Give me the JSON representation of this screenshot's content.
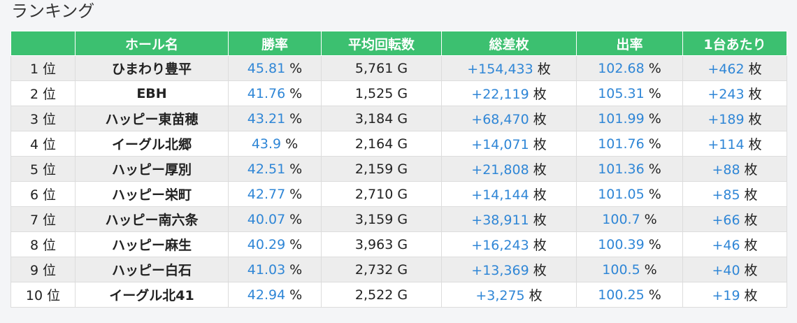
{
  "page": {
    "title": "ランキング"
  },
  "table": {
    "headers": [
      "",
      "ホール名",
      "勝率",
      "平均回転数",
      "総差枚",
      "出率",
      "1台あたり"
    ],
    "units": {
      "rank": "位",
      "percent": "%",
      "spins": "G",
      "coins": "枚"
    },
    "rows": [
      {
        "rank": "1",
        "hall": "ひまわり豊平",
        "win_rate": "45.81",
        "avg_spins": "5,761",
        "total_diff": "+154,433",
        "payout": "102.68",
        "per_machine": "+462"
      },
      {
        "rank": "2",
        "hall": "EBH",
        "win_rate": "41.76",
        "avg_spins": "1,525",
        "total_diff": "+22,119",
        "payout": "105.31",
        "per_machine": "+243"
      },
      {
        "rank": "3",
        "hall": "ハッピー東苗穂",
        "win_rate": "43.21",
        "avg_spins": "3,184",
        "total_diff": "+68,470",
        "payout": "101.99",
        "per_machine": "+189"
      },
      {
        "rank": "4",
        "hall": "イーグル北郷",
        "win_rate": "43.9",
        "avg_spins": "2,164",
        "total_diff": "+14,071",
        "payout": "101.76",
        "per_machine": "+114"
      },
      {
        "rank": "5",
        "hall": "ハッピー厚別",
        "win_rate": "42.51",
        "avg_spins": "2,159",
        "total_diff": "+21,808",
        "payout": "101.36",
        "per_machine": "+88"
      },
      {
        "rank": "6",
        "hall": "ハッピー栄町",
        "win_rate": "42.77",
        "avg_spins": "2,710",
        "total_diff": "+14,144",
        "payout": "101.05",
        "per_machine": "+85"
      },
      {
        "rank": "7",
        "hall": "ハッピー南六条",
        "win_rate": "40.07",
        "avg_spins": "3,159",
        "total_diff": "+38,911",
        "payout": "100.7",
        "per_machine": "+66"
      },
      {
        "rank": "8",
        "hall": "ハッピー麻生",
        "win_rate": "40.29",
        "avg_spins": "3,963",
        "total_diff": "+16,243",
        "payout": "100.39",
        "per_machine": "+46"
      },
      {
        "rank": "9",
        "hall": "ハッピー白石",
        "win_rate": "41.03",
        "avg_spins": "2,732",
        "total_diff": "+13,369",
        "payout": "100.5",
        "per_machine": "+40"
      },
      {
        "rank": "10",
        "hall": "イーグル北41",
        "win_rate": "42.94",
        "avg_spins": "2,522",
        "total_diff": "+3,275",
        "payout": "100.25",
        "per_machine": "+19"
      }
    ]
  },
  "colors": {
    "header_bg": "#3cc070",
    "value_blue": "#2f86d6",
    "row_stripe": "#ededed"
  }
}
